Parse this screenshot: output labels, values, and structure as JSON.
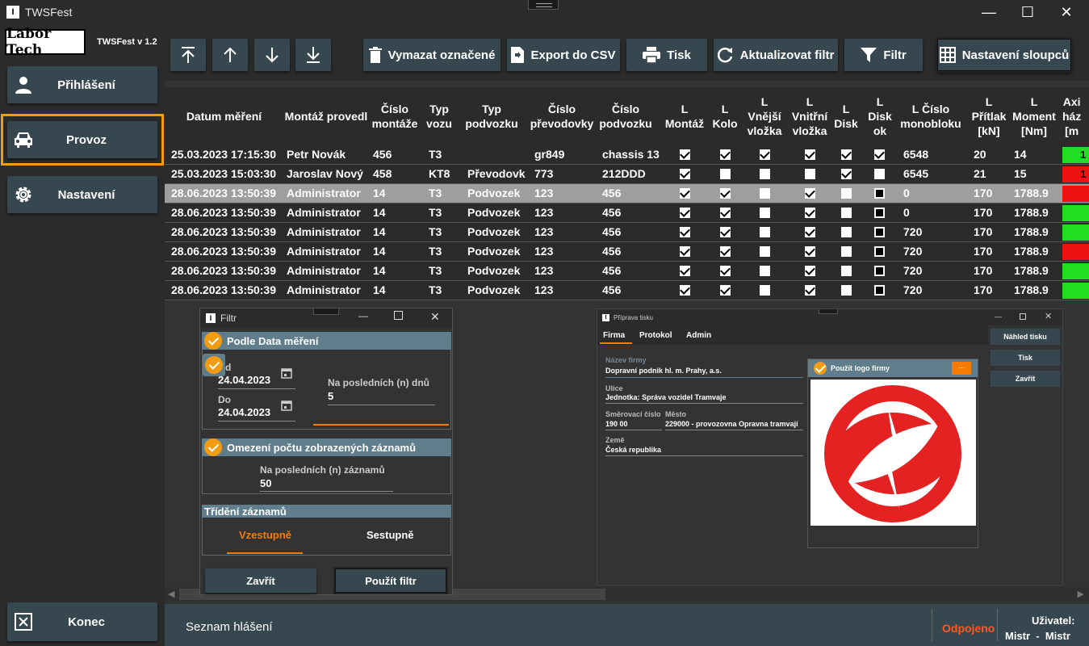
{
  "window": {
    "title": "TWSFest",
    "minimize": "—",
    "maximize": "☐",
    "close": "✕"
  },
  "sidebar": {
    "logo_text": "Labor Tech",
    "version": "TWSFest v 1.2",
    "items": [
      {
        "label": "Přihlášení",
        "icon": "user-icon"
      },
      {
        "label": "Provoz",
        "icon": "car-icon"
      },
      {
        "label": "Nastavení",
        "icon": "gear-icon"
      }
    ],
    "exit_label": "Konec"
  },
  "toolbar": {
    "delete_label": "Vymazat označené",
    "export_label": "Export do CSV",
    "print_label": "Tisk",
    "refresh_label": "Aktualizovat filtr",
    "filter_label": "Filtr",
    "columns_label": "Nastavení sloupců"
  },
  "table": {
    "headers": [
      "Datum měření",
      "Montáž provedl",
      "Číslo\nmontáže",
      "Typ\nvozu",
      "Typ\npodvozku",
      "Číslo\npřevodovky",
      "Číslo\npodvozku",
      "L\nMontáž",
      "L\nKolo",
      "L\nVnější\nvložka",
      "L\nVnitřní\nvložka",
      "L\nDisk",
      "L\nDisk\nok",
      "L Číslo\nmonobloku",
      "L\nPřítlak\n[kN]",
      "L\nMoment\n[Nm]",
      "Axi\nház\n[m"
    ],
    "rows": [
      {
        "date": "25.03.2023 17:15:30",
        "by": "Petr Novák",
        "num": "456",
        "car": "T3",
        "bogie": "",
        "gear": "gr849",
        "chassis": "chassis 13",
        "checks": [
          1,
          1,
          1,
          1,
          1,
          1
        ],
        "mono": "6548",
        "force": "20",
        "moment": "14",
        "axis": "1",
        "status_color": "#22dd22",
        "selected": false
      },
      {
        "date": "25.03.2023 15:03:30",
        "by": "Jaroslav Nový",
        "num": "458",
        "car": "KT8",
        "bogie": "Převodovka",
        "gear": "773",
        "chassis": "212DDD",
        "checks": [
          1,
          0,
          0,
          0,
          1,
          0
        ],
        "mono": "6545",
        "force": "21",
        "moment": "15",
        "axis": "1",
        "status_color": "#ee1111",
        "selected": false
      },
      {
        "date": "28.06.2023 13:50:39",
        "by": "Administrator",
        "num": "14",
        "car": "T3",
        "bogie": "Podvozek",
        "gear": "123",
        "chassis": "456",
        "checks": [
          1,
          1,
          0,
          1,
          0,
          2
        ],
        "mono": "0",
        "force": "170",
        "moment": "1788.9",
        "axis": "",
        "status_color": "#ee1111",
        "selected": true
      },
      {
        "date": "28.06.2023 13:50:39",
        "by": "Administrator",
        "num": "14",
        "car": "T3",
        "bogie": "Podvozek",
        "gear": "123",
        "chassis": "456",
        "checks": [
          1,
          1,
          0,
          1,
          0,
          2
        ],
        "mono": "0",
        "force": "170",
        "moment": "1788.9",
        "axis": "",
        "status_color": "#22dd22",
        "selected": false
      },
      {
        "date": "28.06.2023 13:50:39",
        "by": "Administrator",
        "num": "14",
        "car": "T3",
        "bogie": "Podvozek",
        "gear": "123",
        "chassis": "456",
        "checks": [
          1,
          1,
          0,
          1,
          0,
          2
        ],
        "mono": "720",
        "force": "170",
        "moment": "1788.9",
        "axis": "",
        "status_color": "#22dd22",
        "selected": false
      },
      {
        "date": "28.06.2023 13:50:39",
        "by": "Administrator",
        "num": "14",
        "car": "T3",
        "bogie": "Podvozek",
        "gear": "123",
        "chassis": "456",
        "checks": [
          1,
          1,
          0,
          1,
          0,
          2
        ],
        "mono": "720",
        "force": "170",
        "moment": "1788.9",
        "axis": "",
        "status_color": "#ee1111",
        "selected": false
      },
      {
        "date": "28.06.2023 13:50:39",
        "by": "Administrator",
        "num": "14",
        "car": "T3",
        "bogie": "Podvozek",
        "gear": "123",
        "chassis": "456",
        "checks": [
          1,
          1,
          0,
          1,
          0,
          2
        ],
        "mono": "720",
        "force": "170",
        "moment": "1788.9",
        "axis": "",
        "status_color": "#22dd22",
        "selected": false
      },
      {
        "date": "28.06.2023 13:50:39",
        "by": "Administrator",
        "num": "14",
        "car": "T3",
        "bogie": "Podvozek",
        "gear": "123",
        "chassis": "456",
        "checks": [
          1,
          1,
          0,
          1,
          0,
          2
        ],
        "mono": "720",
        "force": "170",
        "moment": "1788.9",
        "axis": "",
        "status_color": "#22dd22",
        "selected": false
      }
    ]
  },
  "filter_dialog": {
    "title": "Filtr",
    "by_date_label": "Podle Data měření",
    "from_label": "d",
    "from_value": "24.04.2023",
    "to_label": "Do",
    "to_value": "24.04.2023",
    "last_days_label": "Na posledních (n) dnů",
    "last_days_value": "5",
    "limit_label": "Omezení počtu zobrazených záznamů",
    "last_records_label": "Na posledních (n) záznamů",
    "last_records_value": "50",
    "sort_label": "Třídění záznamů",
    "ascending": "Vzestupně",
    "descending": "Sestupně",
    "close_label": "Zavřít",
    "apply_label": "Použít filtr"
  },
  "print_dialog": {
    "title": "Příprava tisku",
    "tabs": [
      "Firma",
      "Protokol",
      "Admin"
    ],
    "company_name_label": "Název firmy",
    "company_name": "Dopravní podnik hl. m. Prahy, a.s.",
    "street_label": "Ulice",
    "street": "Jednotka: Správa vozidel Tramvaje",
    "zip_label": "Směrovací číslo",
    "zip": "190 00",
    "city_label": "Město",
    "city": "229000 - provozovna Opravna tramvají",
    "country_label": "Země",
    "country": "Česká republika",
    "use_logo_label": "Použít logo firmy",
    "browse_label": "...",
    "preview_label": "Náhled tisku",
    "print_label": "Tisk",
    "close_label": "Zavřít"
  },
  "statusbar": {
    "messages_label": "Seznam hlášení",
    "connection": "Odpojeno",
    "user_label": "Uživatel:",
    "user_value": "Mistr  -  Mistr"
  },
  "colors": {
    "accent": "#f39c12",
    "button": "#37474f",
    "header": "#607d8b",
    "ok": "#22dd22",
    "fail": "#ee1111",
    "disconnected": "#ff5722"
  }
}
